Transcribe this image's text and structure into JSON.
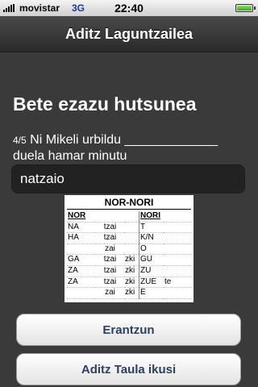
{
  "status": {
    "carrier": "movistar",
    "network": "3G",
    "time": "22:40"
  },
  "nav": {
    "title": "Aditz Laguntzailea"
  },
  "main": {
    "heading": "Bete ezazu hutsunea",
    "question_number": "4/5",
    "question_text": " Ni Mikeli urbildu _____________ duela hamar minutu",
    "answer_value": "natzaio"
  },
  "table": {
    "title": "NOR-NORI",
    "header": [
      "NOR",
      "",
      "",
      "NORI",
      ""
    ],
    "rows": [
      [
        "NA",
        "tzai",
        "",
        "T",
        ""
      ],
      [
        "HA",
        "tzai",
        "",
        "K/N",
        ""
      ],
      [
        "",
        "zai",
        "",
        "O",
        ""
      ],
      [
        "GA",
        "tzai",
        "zki",
        "GU",
        ""
      ],
      [
        "ZA",
        "tzai",
        "zki",
        "ZU",
        ""
      ],
      [
        "ZA",
        "tzai",
        "zki",
        "ZUE",
        "te"
      ],
      [
        "",
        "zai",
        "zki",
        "E",
        ""
      ]
    ]
  },
  "buttons": {
    "answer": "Erantzun",
    "view_table": "Aditz Taula ikusi"
  },
  "colors": {
    "background": "#3a3a3a",
    "button_text": "#2e3f63"
  }
}
